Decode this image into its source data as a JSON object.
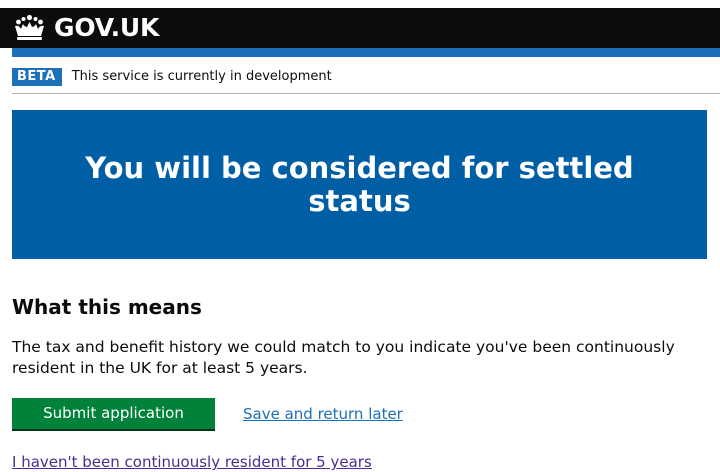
{
  "header": {
    "logo_icon": "crown-icon",
    "service_name": "GOV.UK",
    "bar_color": "#1d70b8"
  },
  "phase_banner": {
    "tag": "BETA",
    "text": "This service is currently in development"
  },
  "panel": {
    "title": "You will be considered for settled status",
    "color": "#005ea5"
  },
  "main": {
    "heading": "What this means",
    "body": "The tax and benefit history we could match to you indicate you've been continuously resident in the UK for at least 5 years.",
    "submit_label": "Submit application",
    "submit_color": "#00823b",
    "save_link": "Save and return later",
    "not_resident_link": "I haven't been continuously resident for 5 years"
  }
}
